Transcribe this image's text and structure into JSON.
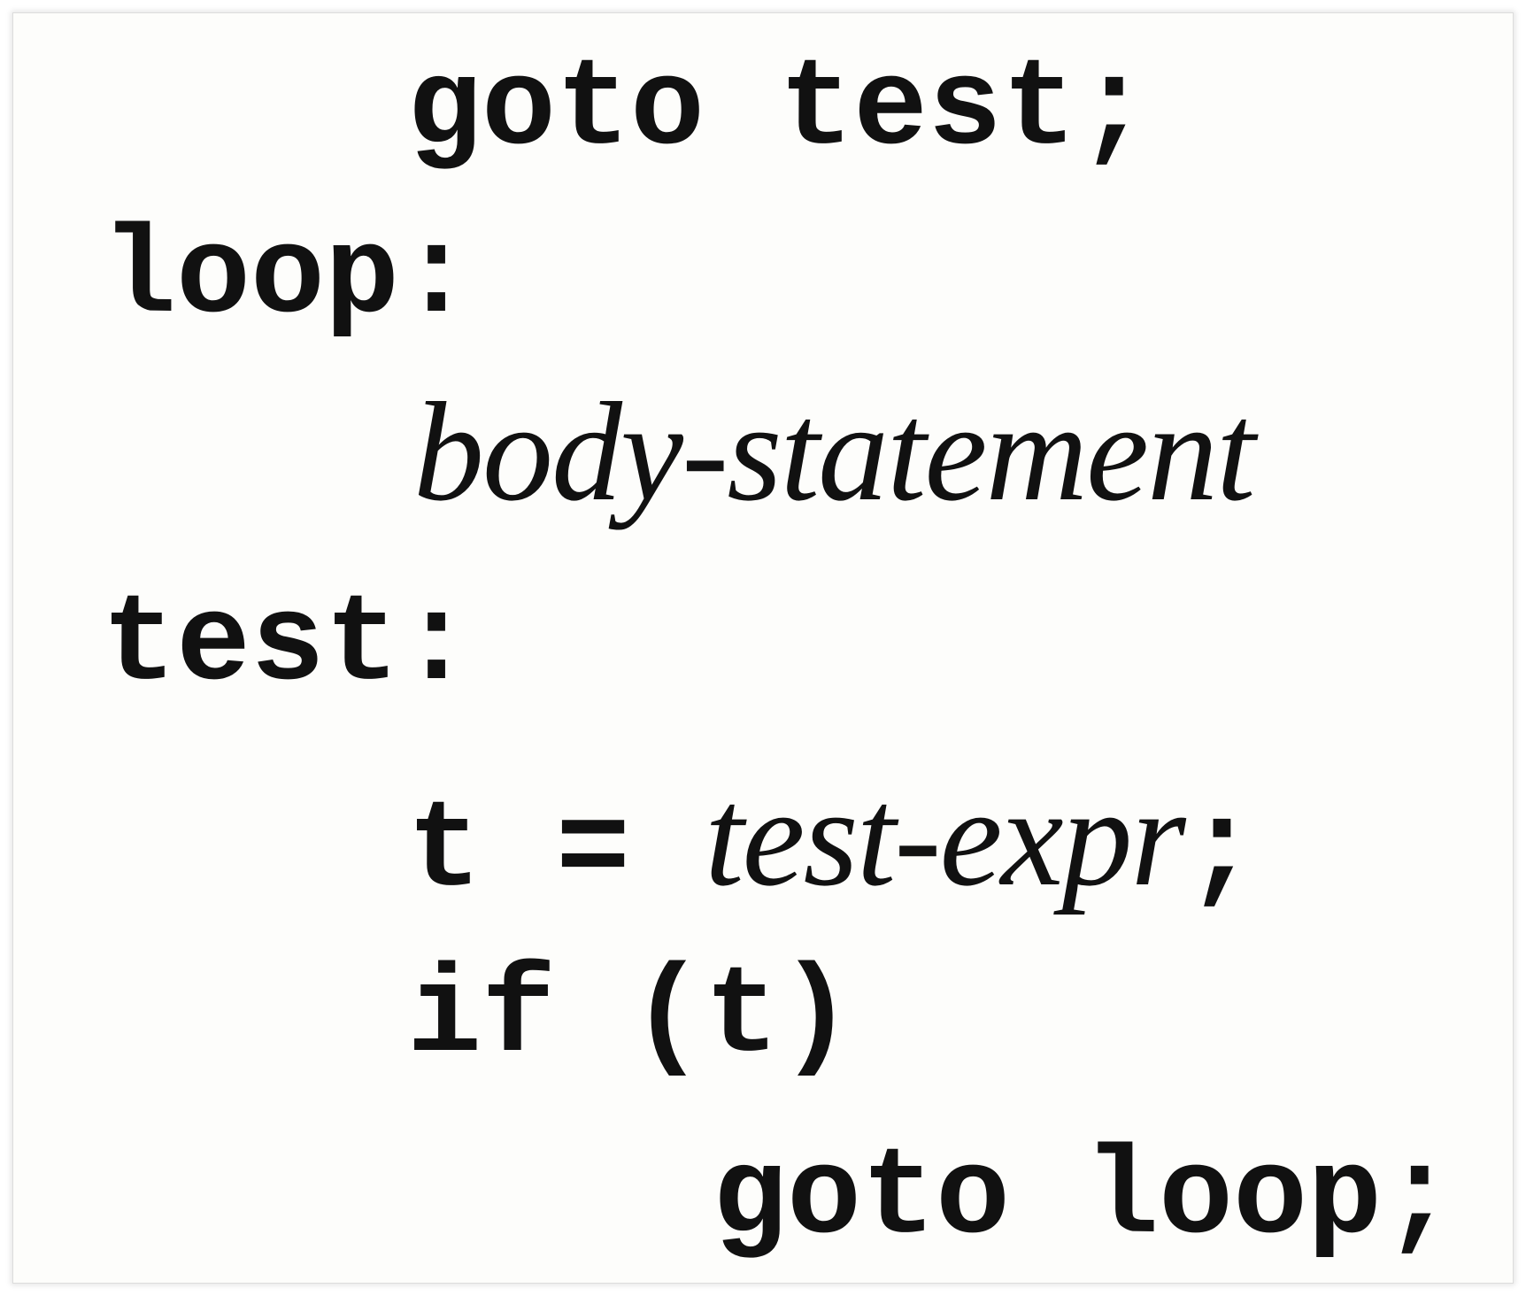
{
  "code": {
    "line1": "goto test;",
    "line2": "loop:",
    "line3": "body-statement",
    "line4": "test:",
    "line5_pre": "t = ",
    "line5_expr": "test-expr",
    "line5_post": ";",
    "line6": "if (t)",
    "line7": "goto loop;"
  }
}
